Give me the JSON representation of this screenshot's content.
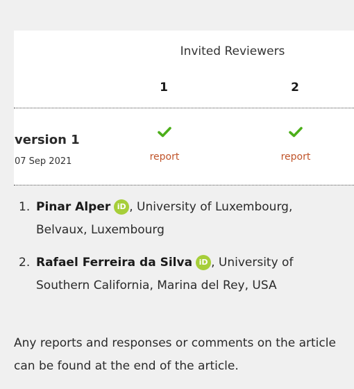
{
  "reviewers_table": {
    "header": "Invited Reviewers",
    "columns": [
      "1",
      "2"
    ],
    "rows": [
      {
        "version": "version 1",
        "date": "07 Sep 2021",
        "reports": [
          {
            "status": "approved",
            "icon": "check-icon",
            "label": "report"
          },
          {
            "status": "approved",
            "icon": "check-icon",
            "label": "report"
          }
        ]
      }
    ]
  },
  "reviewers": [
    {
      "number": "1.",
      "name": "Pinar Alper",
      "orcid_icon": "orcid-icon",
      "orcid_text": "iD",
      "affiliation": ", University of Luxembourg, Belvaux, Luxembourg"
    },
    {
      "number": "2.",
      "name": "Rafael Ferreira da Silva",
      "orcid_icon": "orcid-icon",
      "orcid_text": "iD",
      "affiliation": ", University of Southern California, Marina del Rey, USA"
    }
  ],
  "footer_note": "Any reports and responses or comments on the article can be found at the end of the article.",
  "colors": {
    "panel_bg": "#f0f0f0",
    "check_green": "#4caf1a",
    "report_link": "#c0542a",
    "orcid_green": "#a6ce39"
  }
}
